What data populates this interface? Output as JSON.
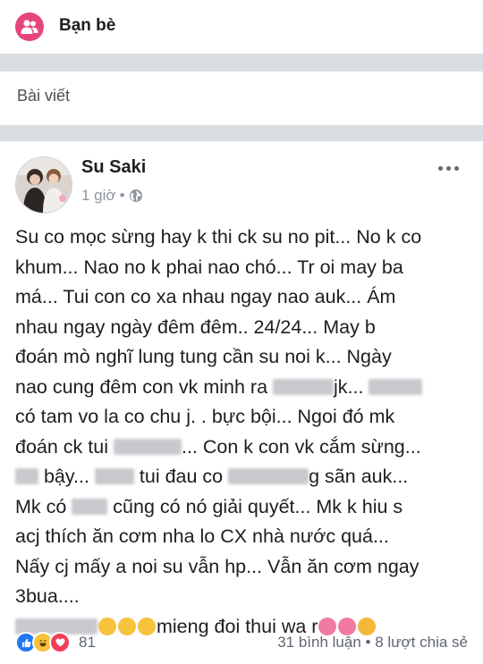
{
  "friends_section": {
    "label": "Bạn bè",
    "icon": "friends-icon",
    "accent": "#e6457a"
  },
  "posts_section": {
    "label": "Bài viết"
  },
  "post": {
    "author": "Su Saki",
    "time": "1 giờ",
    "separator": "•",
    "privacy_icon": "globe-icon",
    "lines": [
      "Su co mọc sừng hay k thi ck su no pit... No k co",
      "khum... Nao no k phai nao chó... Tr oi may ba",
      "má... Tui con co xa nhau ngay nao auk... Ám",
      "nhau ngay ngày đêm đêm.. 24/24... May b",
      "đoán mò nghĩ lung tung cần su noi k... Ngày"
    ],
    "line6_a": "nao cung đêm con vk minh ra ",
    "line6_b": "jk... ",
    "line7": "có tam vo la co chu j. . bực bội... Ngoi đó mk",
    "line8_a": "đoán ck tui ",
    "line8_b": "... Con k con vk cắm sừng...",
    "line9_a": " bậy... ",
    "line9_b": " tui đau co ",
    "line9_c": "g sãn auk...",
    "line10_a": "Mk có ",
    "line10_b": " cũng có nó giải quyết... Mk k hiu s",
    "lines_tail": [
      "acj thích ăn cơm nha lo CX nhà nước  quá...",
      "Nấy cj mấy a noi su vẫn hp... Vẫn ăn cơm ngay",
      "3bua...."
    ],
    "line_last_a": "mieng đoi thui wa r",
    "reaction_count": "81",
    "comments": "31 bình luận",
    "dot": "•",
    "shares": "8 lượt chia sẻ"
  },
  "colors": {
    "like": "#2078f4",
    "haha": "#f7c23c",
    "love": "#f33e58"
  }
}
